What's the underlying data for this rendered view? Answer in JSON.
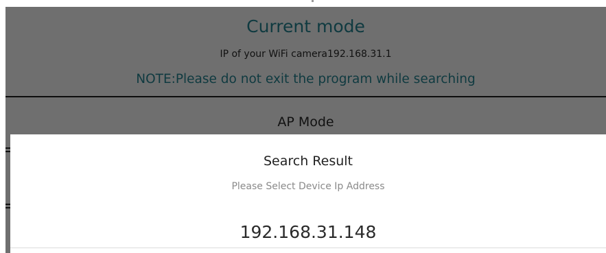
{
  "background_screen": {
    "title": "Current mode",
    "ip_line": "IP of your WiFi camera192.168.31.1",
    "note": "NOTE:Please do not exit the program while searching",
    "mode_option": "AP Mode"
  },
  "dialog": {
    "title": "Search Result",
    "subtitle": "Please Select Device Ip Address",
    "devices": [
      {
        "ip": "192.168.31.148"
      }
    ]
  },
  "colors": {
    "dim_overlay": "#6f6f6f",
    "heading_teal": "#0f3a40",
    "dialog_background": "#ffffff",
    "subtitle_gray": "#8a8a8a"
  }
}
